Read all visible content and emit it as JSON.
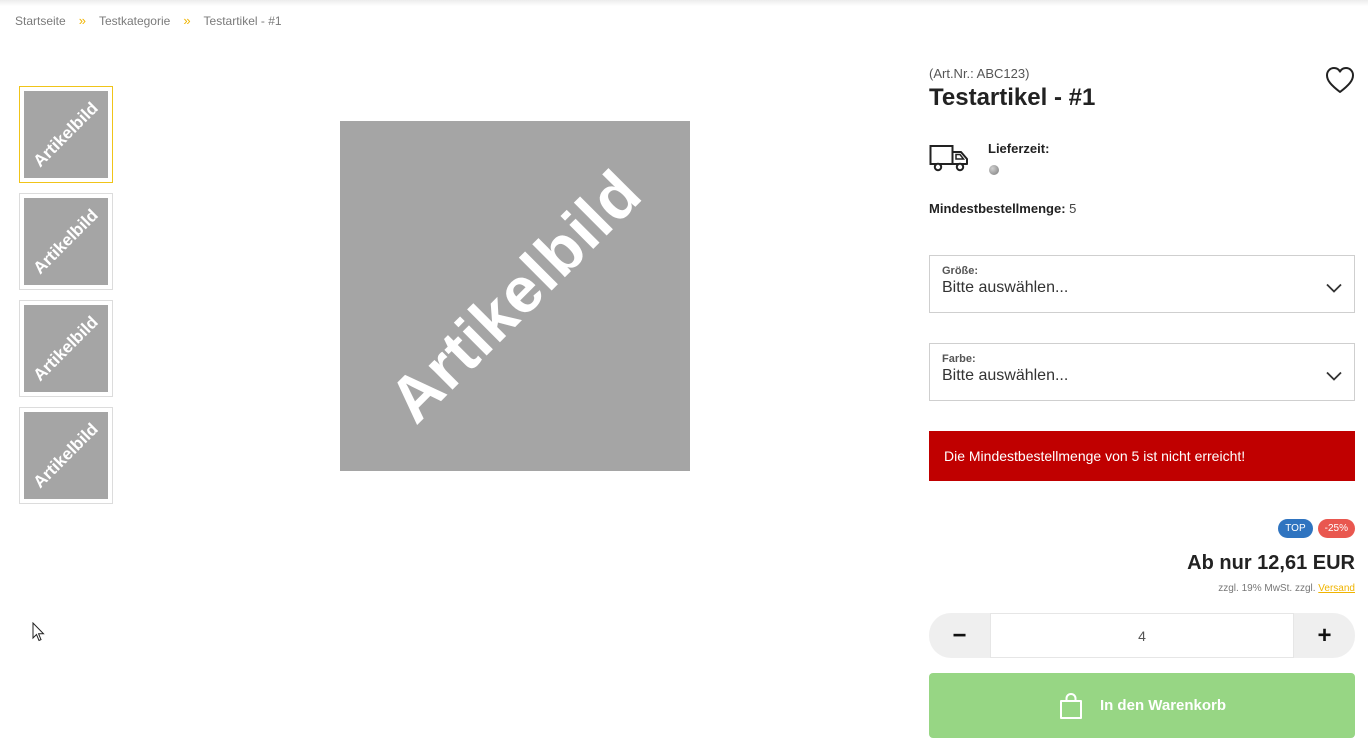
{
  "breadcrumb": {
    "items": [
      "Startseite",
      "Testkategorie",
      "Testartikel - #1"
    ],
    "separator": "»"
  },
  "gallery": {
    "placeholder_text": "Artikelbild",
    "thumbnails": [
      "Artikelbild",
      "Artikelbild",
      "Artikelbild",
      "Artikelbild"
    ]
  },
  "product": {
    "art_nr": "(Art.Nr.: ABC123)",
    "title": "Testartikel - #1",
    "delivery_label": "Lieferzeit:",
    "min_qty_label": "Mindestbestellmenge:",
    "min_qty_value": "5"
  },
  "options": {
    "size": {
      "label": "Größe:",
      "value": "Bitte auswählen..."
    },
    "color": {
      "label": "Farbe:",
      "value": "Bitte auswählen..."
    }
  },
  "alert": "Die Mindestbestellmenge von 5 ist nicht erreicht!",
  "badges": {
    "top": "TOP",
    "discount": "-25%"
  },
  "price": {
    "text": "Ab nur 12,61 EUR",
    "tax_prefix": "zzgl. 19% MwSt. zzgl.",
    "shipping_link": "Versand"
  },
  "quantity": {
    "minus": "−",
    "value": "4",
    "plus": "+"
  },
  "cart_button": "In den Warenkorb",
  "colors": {
    "accent_yellow": "#f0b400",
    "alert_red": "#c00000",
    "cart_green": "#97d684",
    "badge_blue": "#2f74c0",
    "badge_red": "#e9574f"
  },
  "icons": [
    "heart-icon",
    "truck-icon",
    "chevron-down-icon",
    "shopping-bag-icon",
    "cursor-icon"
  ]
}
